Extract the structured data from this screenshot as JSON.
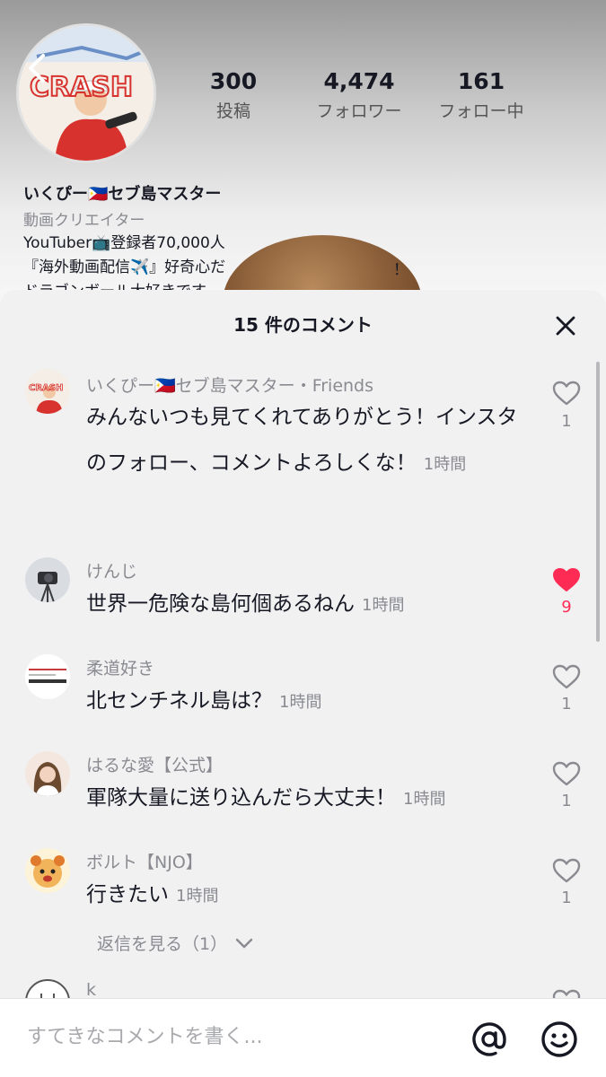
{
  "profile": {
    "back_icon": "chevron-left-icon",
    "avatar_text": "CRASH",
    "stats": [
      {
        "value": "300",
        "label": "投稿"
      },
      {
        "value": "4,474",
        "label": "フォロワー"
      },
      {
        "value": "161",
        "label": "フォロー中"
      }
    ],
    "name": "いくぴー🇵🇭セブ島マスター",
    "category": "動画クリエイター",
    "bio_line1": "YouTuber📺登録者70,000人",
    "bio_line2": "『海外動画配信✈️』好奇心だ",
    "bio_line2_tail": "！",
    "bio_line3": "ドラゴンボール大好きです"
  },
  "sheet": {
    "title": "15 件のコメント",
    "close_icon": "close-icon"
  },
  "comments": [
    {
      "author": "いくぴー🇵🇭セブ島マスター",
      "separator": "・",
      "tag": "Friends",
      "text": "みんないつも見てくれてありがとう！インスタのフォロー、コメントよろしくな！",
      "time": "1時間",
      "likes": "1",
      "liked": false
    },
    {
      "author": "けんじ",
      "text": "世界一危険な島何個あるねん",
      "time": "1時間",
      "likes": "9",
      "liked": true
    },
    {
      "author": "柔道好き",
      "text": "北センチネル島は？",
      "time": "1時間",
      "likes": "1",
      "liked": false
    },
    {
      "author": "はるな愛【公式】",
      "text": "軍隊大量に送り込んだら大丈夫！",
      "time": "1時間",
      "likes": "1",
      "liked": false
    },
    {
      "author": "ボルト【NJO】",
      "text": "行きたい",
      "time": "1時間",
      "likes": "1",
      "liked": false,
      "replies_label": "返信を見る（1）"
    },
    {
      "author": "k"
    }
  ],
  "input": {
    "placeholder": "すてきなコメントを書く...",
    "value": ""
  },
  "colors": {
    "accent_like": "#fe2c55",
    "sheet_bg": "#f1f1f2",
    "muted_text": "#8a8b91"
  }
}
